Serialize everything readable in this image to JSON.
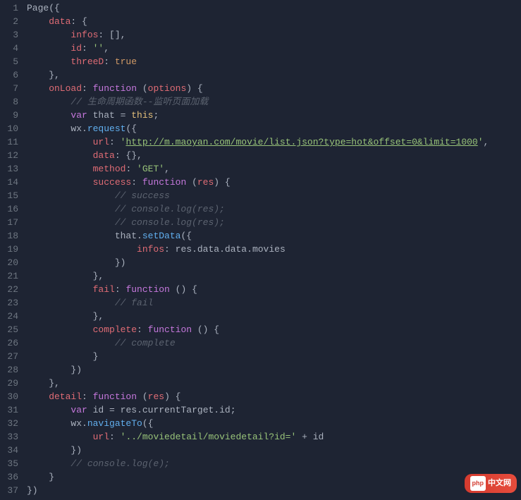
{
  "lines": [
    [
      [
        "ident",
        "Page"
      ],
      [
        "punct",
        "({"
      ]
    ],
    [
      [
        "prop",
        "    data"
      ],
      [
        "punct",
        ": {"
      ]
    ],
    [
      [
        "prop",
        "        infos"
      ],
      [
        "punct",
        ": [],"
      ]
    ],
    [
      [
        "prop",
        "        id"
      ],
      [
        "punct",
        ": "
      ],
      [
        "string",
        "''"
      ],
      [
        "punct",
        ","
      ]
    ],
    [
      [
        "prop",
        "        threeD"
      ],
      [
        "punct",
        ": "
      ],
      [
        "bool",
        "true"
      ]
    ],
    [
      [
        "punct",
        "    },"
      ]
    ],
    [
      [
        "prop",
        "    onLoad"
      ],
      [
        "punct",
        ": "
      ],
      [
        "keyword",
        "function"
      ],
      [
        "punct",
        " ("
      ],
      [
        "param",
        "options"
      ],
      [
        "punct",
        ") {"
      ]
    ],
    [
      [
        "comment",
        "        // 生命周期函数--监听页面加载"
      ]
    ],
    [
      [
        "keyword",
        "        var"
      ],
      [
        "ident",
        " that "
      ],
      [
        "punct",
        "= "
      ],
      [
        "this",
        "this"
      ],
      [
        "punct",
        ";"
      ]
    ],
    [
      [
        "ident",
        "        wx"
      ],
      [
        "punct",
        "."
      ],
      [
        "func",
        "request"
      ],
      [
        "punct",
        "({"
      ]
    ],
    [
      [
        "prop",
        "            url"
      ],
      [
        "punct",
        ": "
      ],
      [
        "string",
        "'"
      ],
      [
        "url",
        "http://m.maoyan.com/movie/list.json?type=hot&offset=0&limit=1000"
      ],
      [
        "string",
        "'"
      ],
      [
        "punct",
        ","
      ]
    ],
    [
      [
        "prop",
        "            data"
      ],
      [
        "punct",
        ": {},"
      ]
    ],
    [
      [
        "prop",
        "            method"
      ],
      [
        "punct",
        ": "
      ],
      [
        "string",
        "'GET'"
      ],
      [
        "punct",
        ","
      ]
    ],
    [
      [
        "prop",
        "            success"
      ],
      [
        "punct",
        ": "
      ],
      [
        "keyword",
        "function"
      ],
      [
        "punct",
        " ("
      ],
      [
        "param",
        "res"
      ],
      [
        "punct",
        ") {"
      ]
    ],
    [
      [
        "comment",
        "                // success"
      ]
    ],
    [
      [
        "comment",
        "                // console.log(res);"
      ]
    ],
    [
      [
        "comment",
        "                // console.log(res);"
      ]
    ],
    [
      [
        "ident",
        "                that"
      ],
      [
        "punct",
        "."
      ],
      [
        "func",
        "setData"
      ],
      [
        "punct",
        "({"
      ]
    ],
    [
      [
        "prop",
        "                    infos"
      ],
      [
        "punct",
        ": "
      ],
      [
        "ident",
        "res"
      ],
      [
        "punct",
        "."
      ],
      [
        "ident",
        "data"
      ],
      [
        "punct",
        "."
      ],
      [
        "ident",
        "data"
      ],
      [
        "punct",
        "."
      ],
      [
        "ident",
        "movies"
      ]
    ],
    [
      [
        "punct",
        "                })"
      ]
    ],
    [
      [
        "punct",
        "            },"
      ]
    ],
    [
      [
        "prop",
        "            fail"
      ],
      [
        "punct",
        ": "
      ],
      [
        "keyword",
        "function"
      ],
      [
        "punct",
        " () {"
      ]
    ],
    [
      [
        "comment",
        "                // fail"
      ]
    ],
    [
      [
        "punct",
        "            },"
      ]
    ],
    [
      [
        "prop",
        "            complete"
      ],
      [
        "punct",
        ": "
      ],
      [
        "keyword",
        "function"
      ],
      [
        "punct",
        " () {"
      ]
    ],
    [
      [
        "comment",
        "                // complete"
      ]
    ],
    [
      [
        "punct",
        "            }"
      ]
    ],
    [
      [
        "punct",
        "        })"
      ]
    ],
    [
      [
        "punct",
        "    },"
      ]
    ],
    [
      [
        "prop",
        "    detail"
      ],
      [
        "punct",
        ": "
      ],
      [
        "keyword",
        "function"
      ],
      [
        "punct",
        " ("
      ],
      [
        "param",
        "res"
      ],
      [
        "punct",
        ") {"
      ]
    ],
    [
      [
        "keyword",
        "        var"
      ],
      [
        "ident",
        " id "
      ],
      [
        "punct",
        "= "
      ],
      [
        "ident",
        "res"
      ],
      [
        "punct",
        "."
      ],
      [
        "ident",
        "currentTarget"
      ],
      [
        "punct",
        "."
      ],
      [
        "ident",
        "id"
      ],
      [
        "punct",
        ";"
      ]
    ],
    [
      [
        "ident",
        "        wx"
      ],
      [
        "punct",
        "."
      ],
      [
        "func",
        "navigateTo"
      ],
      [
        "punct",
        "({"
      ]
    ],
    [
      [
        "prop",
        "            url"
      ],
      [
        "punct",
        ": "
      ],
      [
        "string",
        "'../moviedetail/moviedetail?id='"
      ],
      [
        "punct",
        " + "
      ],
      [
        "ident",
        "id"
      ]
    ],
    [
      [
        "punct",
        "        })"
      ]
    ],
    [
      [
        "comment",
        "        // console.log(e);"
      ]
    ],
    [
      [
        "punct",
        "    }"
      ]
    ],
    [
      [
        "punct",
        "})"
      ]
    ]
  ],
  "badge": {
    "icon": "php",
    "text": "中文网"
  }
}
